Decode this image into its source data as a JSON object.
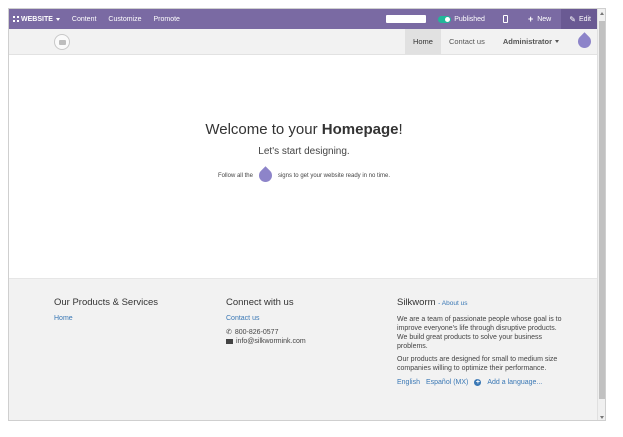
{
  "topbar": {
    "website_label": "WEBSITE",
    "content_label": "Content",
    "customize_label": "Customize",
    "promote_label": "Promote",
    "published_label": "Published",
    "new_label": "New",
    "edit_label": "Edit"
  },
  "navbar": {
    "items": [
      {
        "label": "Home"
      },
      {
        "label": "Contact us"
      }
    ],
    "admin_label": "Administrator"
  },
  "main": {
    "welcome_prefix": "Welcome to your ",
    "welcome_bold": "Homepage",
    "welcome_suffix": "!",
    "subtitle": "Let's start designing.",
    "follow_prefix": "Follow all the",
    "follow_suffix": "signs to get your website ready in no time."
  },
  "footer": {
    "col1": {
      "title": "Our Products & Services",
      "link": "Home"
    },
    "col2": {
      "title": "Connect with us",
      "link": "Contact us",
      "phone": "800-826-0577",
      "email": "info@silkwormink.com"
    },
    "col3": {
      "title": "Silkworm",
      "about": "- About us",
      "para1": "We are a team of passionate people whose goal is to improve everyone's life through disruptive products. We build great products to solve your business problems.",
      "para2": "Our products are designed for small to medium size companies willing to optimize their performance.",
      "lang1": "English",
      "lang2": "Español (MX)",
      "add_language": "Add a language..."
    }
  },
  "colors": {
    "topbar": "#7a6aa3",
    "accent_drop": "#8d84c9",
    "link": "#3a78b5",
    "toggle_on": "#21b799"
  }
}
